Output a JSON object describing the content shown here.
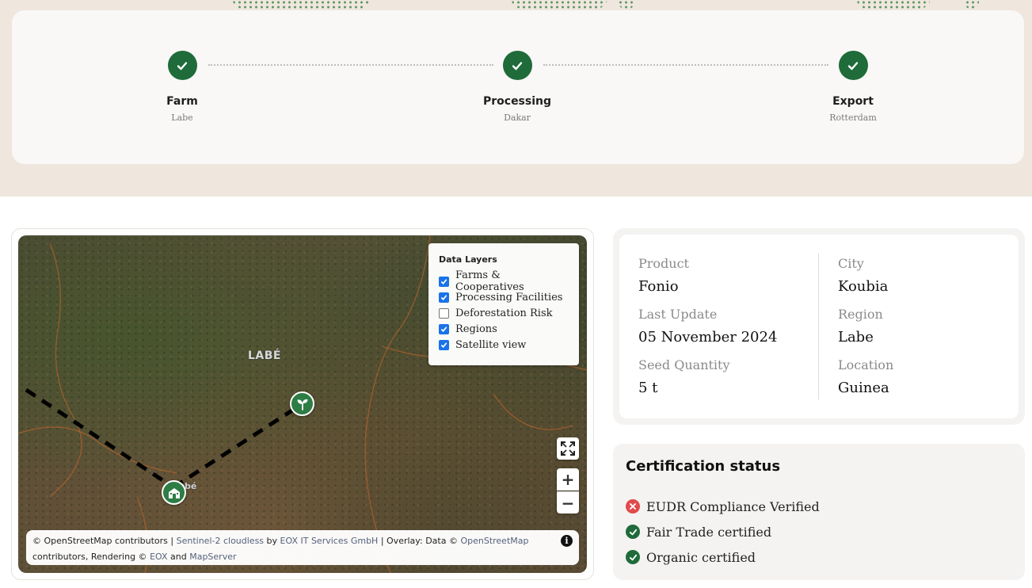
{
  "tracker": {
    "steps": [
      {
        "title": "Farm",
        "location": "Labe"
      },
      {
        "title": "Processing",
        "location": "Dakar"
      },
      {
        "title": "Export",
        "location": "Rotterdam"
      }
    ]
  },
  "map": {
    "city_label": "LABÉ",
    "small_label": "bé",
    "layers_panel": {
      "title": "Data Layers",
      "layers": [
        {
          "label": "Farms & Cooperatives",
          "checked": true
        },
        {
          "label": "Processing Facilities",
          "checked": true
        },
        {
          "label": "Deforestation Risk",
          "checked": false
        },
        {
          "label": "Regions",
          "checked": true
        },
        {
          "label": "Satellite view",
          "checked": true
        }
      ]
    },
    "zoom_in": "+",
    "zoom_out": "−",
    "attribution": {
      "osm": "© OpenStreetMap contributors",
      "sep1": " | ",
      "sentinel": "Sentinel-2 cloudless",
      "by": " by ",
      "eox_services": "EOX IT Services GmbH",
      "overlay": " | Overlay: Data © ",
      "osm_link": "OpenStreetMap",
      "contributors": " contributors, Rendering © ",
      "eox": "EOX",
      "and": " and ",
      "mapserver": "MapServer"
    },
    "info_icon": "i"
  },
  "details": {
    "left": [
      {
        "label": "Product",
        "value": "Fonio"
      },
      {
        "label": "Last Update",
        "value": "05 November 2024"
      },
      {
        "label": "Seed Quantity",
        "value": "5 t"
      }
    ],
    "right": [
      {
        "label": "City",
        "value": "Koubia"
      },
      {
        "label": "Region",
        "value": "Labe"
      },
      {
        "label": "Location",
        "value": "Guinea"
      }
    ]
  },
  "certification": {
    "title": "Certification status",
    "items": [
      {
        "label": "EUDR Compliance Verified",
        "status": "fail"
      },
      {
        "label": "Fair Trade certified",
        "status": "pass"
      },
      {
        "label": "Organic certified",
        "status": "pass"
      }
    ]
  },
  "colors": {
    "brand_green": "#1f6b3a",
    "fail_red": "#e04b4b",
    "band_bg": "#efe6dd",
    "checkbox_blue": "#1a73e8"
  },
  "icons": {
    "step": "check-icon",
    "farm_marker": "sprout-icon",
    "processing_marker": "factory-icon",
    "fullscreen": "fullscreen-icon"
  }
}
